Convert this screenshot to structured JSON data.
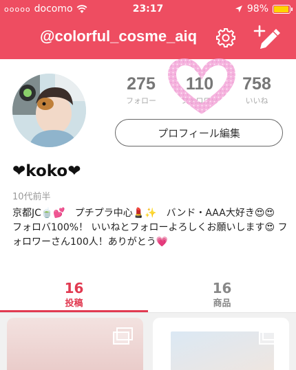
{
  "status_bar": {
    "signal_dots": "ooooo",
    "carrier": "docomo",
    "time": "23:17",
    "battery_text": "98%",
    "battery_level": 0.98,
    "battery_color": "#ffd400"
  },
  "header": {
    "username": "@colorful_cosme_aiq",
    "background_color": "#ee4d61",
    "settings_icon": "gear-icon",
    "compose_icon": "plus-pencil-icon"
  },
  "profile": {
    "stats": [
      {
        "value": "275",
        "label": "フォロー"
      },
      {
        "value": "110",
        "label": "フォロワー"
      },
      {
        "value": "758",
        "label": "いいね"
      }
    ],
    "edit_button_label": "プロフィール編集",
    "name": "❤koko❤",
    "age": "10代前半",
    "bio": "京都JC🍵💕　プチプラ中心💄✨　バンド・AAA大好き😍😍　フォロバ100%！ いいねとフォローよろしくお願いします😍 フォロワーさん100人！ありがとう💗"
  },
  "tabs": [
    {
      "count": "16",
      "label": "投稿",
      "active": true
    },
    {
      "count": "16",
      "label": "商品",
      "active": false
    }
  ],
  "accent_color": "#e13a51"
}
